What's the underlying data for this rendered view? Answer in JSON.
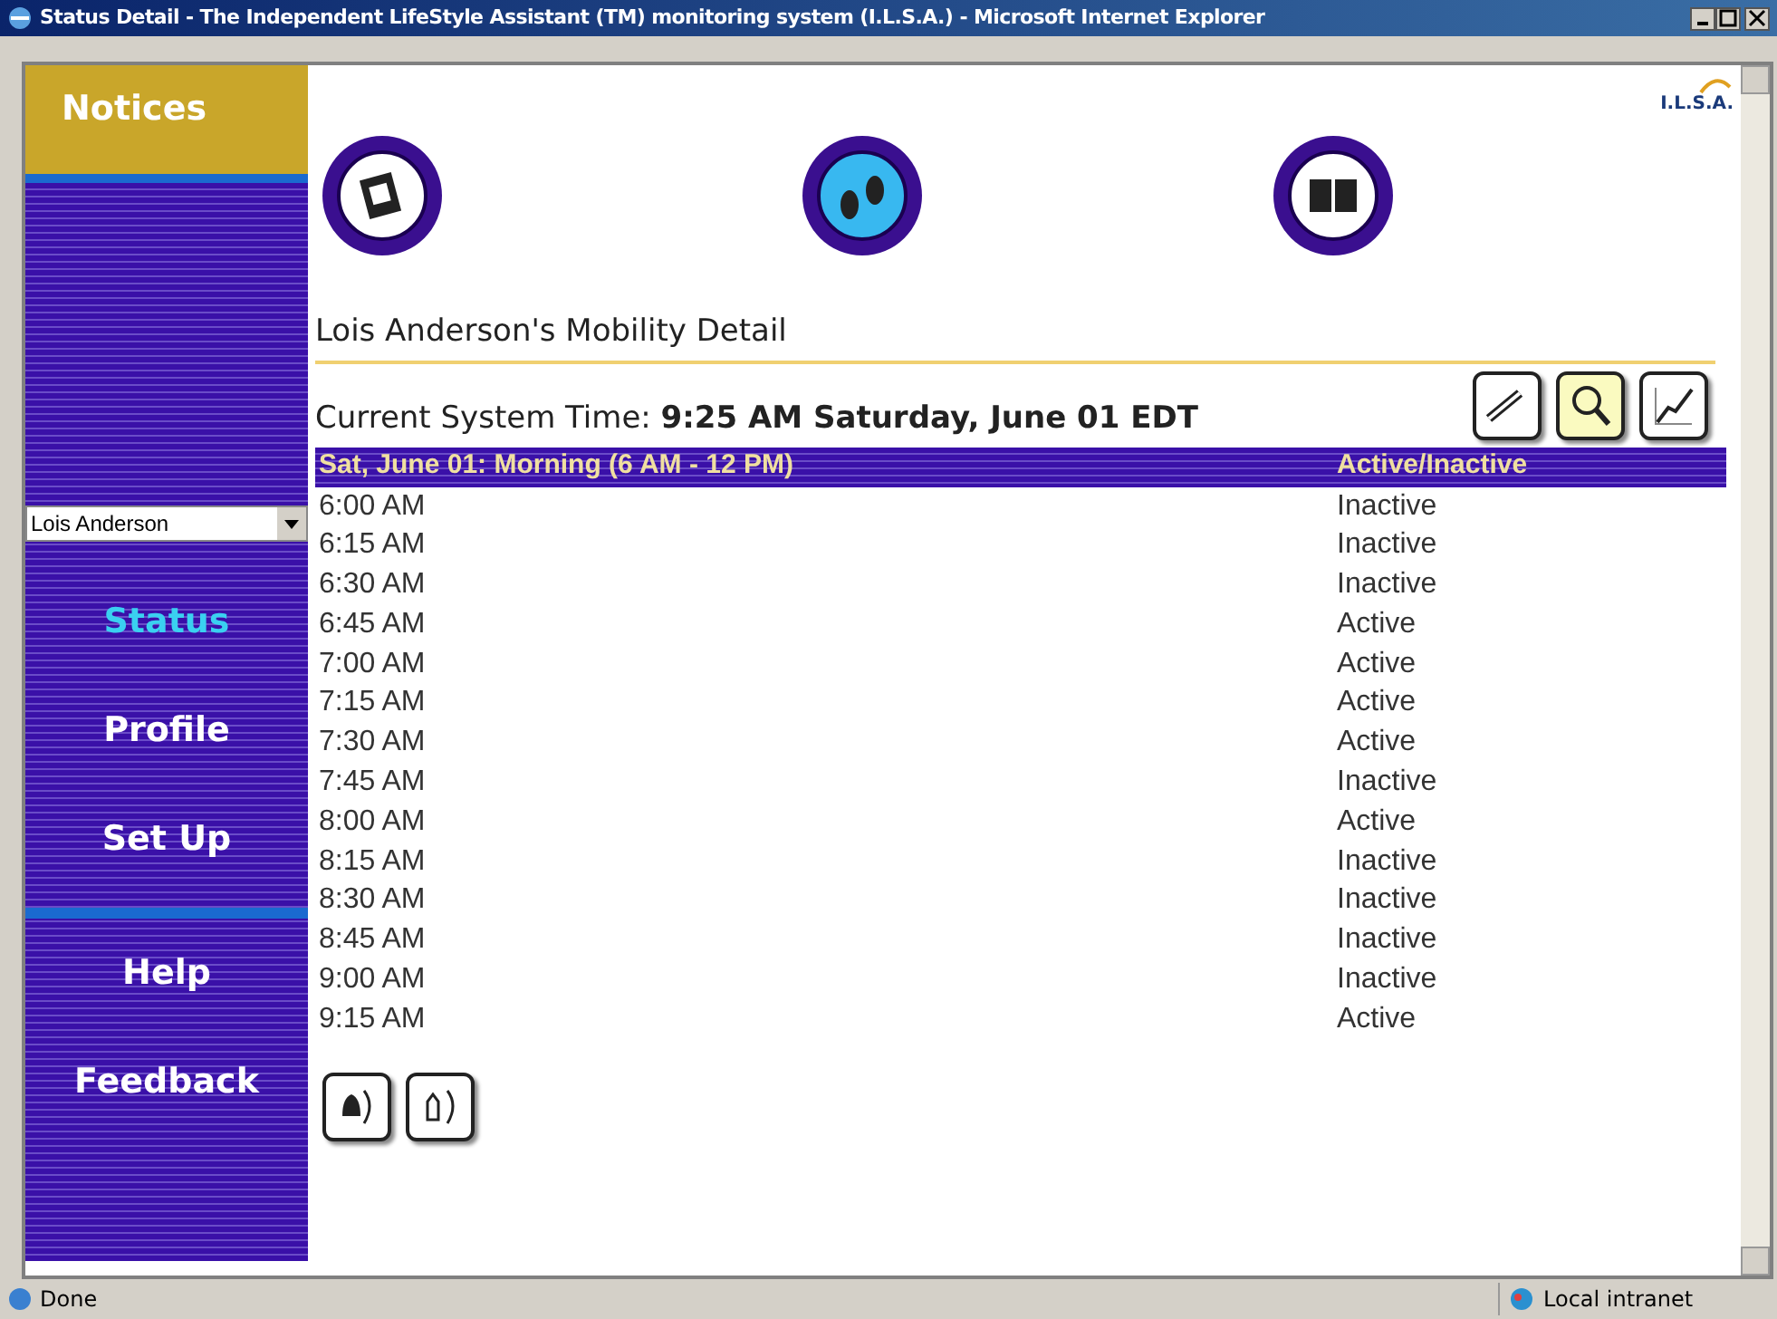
{
  "window": {
    "title": "Status Detail - The Independent LifeStyle Assistant (TM) monitoring system (I.L.S.A.) - Microsoft Internet Explorer"
  },
  "logo": {
    "text": "I.L.S.A."
  },
  "sidebar": {
    "notices": "Notices",
    "user_select": {
      "value": "Lois Anderson"
    },
    "items": [
      {
        "label": "Status",
        "selected": true
      },
      {
        "label": "Profile",
        "selected": false
      },
      {
        "label": "Set Up",
        "selected": false
      },
      {
        "label": "Help",
        "selected": false
      },
      {
        "label": "Feedback",
        "selected": false
      }
    ]
  },
  "heading": "Lois Anderson's Mobility Detail",
  "system_time": {
    "label": "Current System Time:",
    "value": "9:25 AM Saturday, June 01 EDT"
  },
  "table": {
    "columns": [
      "Sat, June 01: Morning (6 AM - 12 PM)",
      "Active/Inactive"
    ],
    "rows": [
      [
        "6:00 AM",
        "Inactive"
      ],
      [
        "6:15 AM",
        "Inactive"
      ],
      [
        "6:30 AM",
        "Inactive"
      ],
      [
        "6:45 AM",
        "Active"
      ],
      [
        "7:00 AM",
        "Active"
      ],
      [
        "7:15 AM",
        "Active"
      ],
      [
        "7:30 AM",
        "Active"
      ],
      [
        "7:45 AM",
        "Inactive"
      ],
      [
        "8:00 AM",
        "Active"
      ],
      [
        "8:15 AM",
        "Inactive"
      ],
      [
        "8:30 AM",
        "Inactive"
      ],
      [
        "8:45 AM",
        "Inactive"
      ],
      [
        "9:00 AM",
        "Inactive"
      ],
      [
        "9:15 AM",
        "Active"
      ]
    ]
  },
  "status_bar": {
    "text": "Done",
    "zone": "Local intranet"
  }
}
